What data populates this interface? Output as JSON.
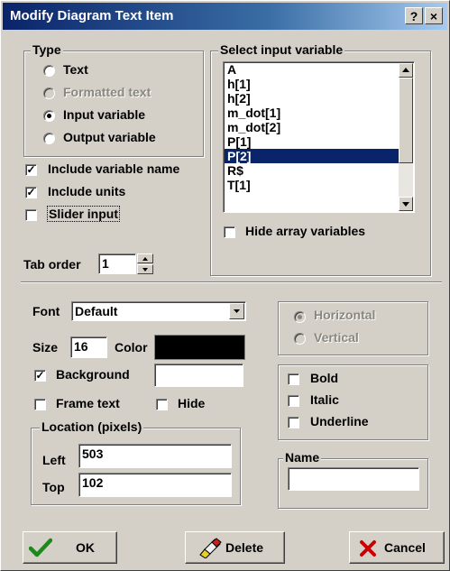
{
  "window": {
    "title": "Modify Diagram Text Item",
    "help_button": "?",
    "close_button": "×"
  },
  "type_group": {
    "title": "Type",
    "options": [
      {
        "label": "Text",
        "selected": false,
        "enabled": true
      },
      {
        "label": "Formatted text",
        "selected": false,
        "enabled": false
      },
      {
        "label": "Input variable",
        "selected": true,
        "enabled": true
      },
      {
        "label": "Output variable",
        "selected": false,
        "enabled": true
      }
    ]
  },
  "options": {
    "include_variable_name": {
      "label": "Include variable name",
      "checked": true
    },
    "include_units": {
      "label": "Include units",
      "checked": true
    },
    "slider_input": {
      "label": "Slider input",
      "checked": false
    }
  },
  "tab_order": {
    "label": "Tab order",
    "value": "1"
  },
  "variable_group": {
    "title": "Select input variable",
    "items": [
      "A",
      "h[1]",
      "h[2]",
      "m_dot[1]",
      "m_dot[2]",
      "P[1]",
      "P[2]",
      "R$",
      "T[1]"
    ],
    "selected": "P[2]",
    "hide_array": {
      "label": "Hide array variables",
      "checked": false
    }
  },
  "format": {
    "font_label": "Font",
    "font_value": "Default",
    "size_label": "Size",
    "size_value": "16",
    "color_label": "Color",
    "color_value": "#000000",
    "background": {
      "label": "Background",
      "checked": true,
      "value": ""
    },
    "frame_text": {
      "label": "Frame text",
      "checked": false
    },
    "hide": {
      "label": "Hide",
      "checked": false
    }
  },
  "orientation": {
    "horizontal": {
      "label": "Horizontal",
      "selected": true,
      "enabled": false
    },
    "vertical": {
      "label": "Vertical",
      "selected": false,
      "enabled": false
    }
  },
  "style": {
    "bold": {
      "label": "Bold",
      "checked": false
    },
    "italic": {
      "label": "Italic",
      "checked": false
    },
    "underline": {
      "label": "Underline",
      "checked": false
    }
  },
  "location": {
    "title": "Location (pixels)",
    "left_label": "Left",
    "left_value": "503",
    "top_label": "Top",
    "top_value": "102"
  },
  "name_group": {
    "title": "Name",
    "value": ""
  },
  "buttons": {
    "ok": "OK",
    "delete": "Delete",
    "cancel": "Cancel"
  },
  "colors": {
    "title_bar": "#0a246a",
    "selection": "#0a246a",
    "ok_check": "#1a8a1a",
    "cancel_x": "#cc0000",
    "dialog_bg": "#d4d0c8"
  },
  "icons": {
    "ok": "checkmark-icon",
    "delete": "eraser-icon",
    "cancel": "red-x-icon"
  }
}
